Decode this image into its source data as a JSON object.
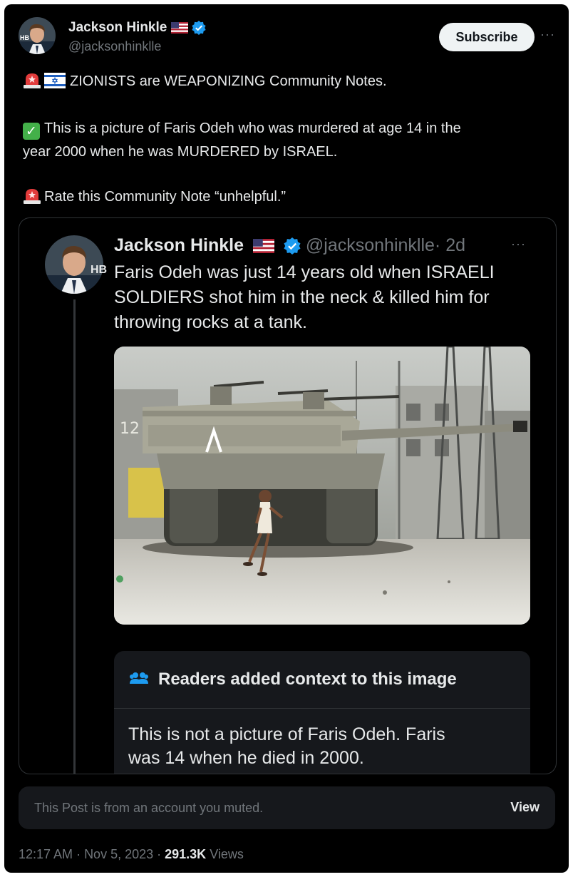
{
  "post": {
    "author_name": "Jackson Hinkle",
    "author_handle": "@jacksonhinklle",
    "subscribe_label": "Subscribe",
    "more_label": "···",
    "lines": [
      "ZIONISTS are WEAPONIZING Community Notes.",
      "This is a picture of Faris Odeh who was murdered at age 14 in the",
      "year 2000 when he was MURDERED by ISRAEL.",
      "Rate this Community Note “unhelpful.”"
    ]
  },
  "quoted": {
    "author_name": "Jackson Hinkle",
    "author_handle": "@jacksonhinklle",
    "time": "· 2d",
    "more_label": "···",
    "lines": [
      "Faris Odeh was just 14 years old when ISRAELI",
      "SOLDIERS shot him in the neck & killed him for",
      "throwing rocks at a tank."
    ],
    "image_tank_number": "12"
  },
  "note": {
    "title": "Readers added context to this image",
    "lines": [
      "This is not a picture of Faris Odeh. Faris",
      "was 14 when he died in 2000."
    ]
  },
  "muted": {
    "text": "This Post is from an account you muted.",
    "view_label": "View"
  },
  "meta": {
    "time": "12:17 AM",
    "sep1": " · ",
    "date": "Nov 5, 2023",
    "sep2": " · ",
    "views_count": "291.3K",
    "views_label": " Views"
  },
  "colors": {
    "background": "#000000",
    "text": "#e7e9ea",
    "secondary": "#71767b",
    "verified_blue": "#1d9bf0",
    "note_bg": "#16181c"
  },
  "icons": {
    "verified": "verified-badge-icon",
    "flag": "us-flag-icon",
    "siren": "siren-icon",
    "israel_flag": "israel-flag-icon",
    "check": "check-mark-icon",
    "readers": "people-icon"
  }
}
